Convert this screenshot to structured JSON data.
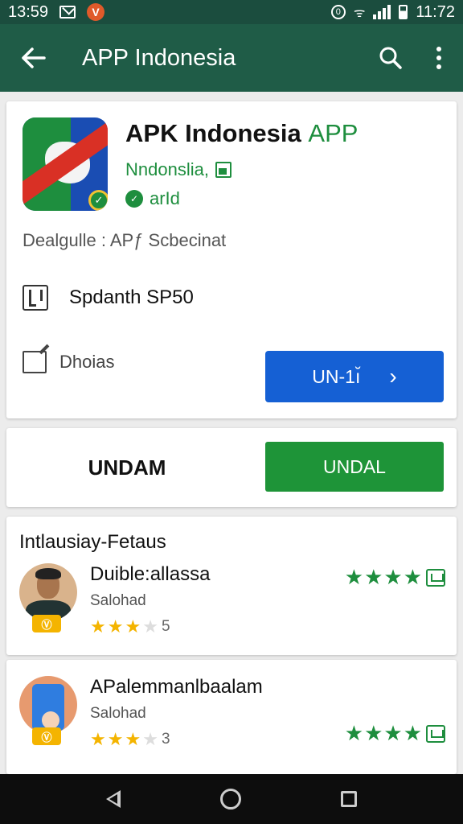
{
  "status_bar": {
    "time": "13:59",
    "notif_badge": "V",
    "right_time": "11:72",
    "circle_icon": "0"
  },
  "appbar": {
    "title": "APP Indonesia"
  },
  "app": {
    "name": "APK Indonesia",
    "name_accent": "APP",
    "developer": "Nndonslia,",
    "rating_text": "arId",
    "description": "Dealgulle : APƒ Scbecinat",
    "size_label": "Spdanth SP50",
    "downloads_label": "Dhoias",
    "install_button": "UN-1ı̆",
    "chevron": "›"
  },
  "action_card": {
    "left_label": "UNDAM",
    "button_label": "UNDAL"
  },
  "reviews_section": {
    "title": "Intlausiay-Fetaus",
    "reviews": [
      {
        "name": "Duible:allassa",
        "subtitle": "Salohad",
        "user_rating": 3,
        "rating_num": "5",
        "app_rating": 4,
        "badge": "Ⓥ"
      },
      {
        "name": "APalemmanlbaalam",
        "subtitle": "Salohad",
        "user_rating": 3,
        "rating_num": "3",
        "app_rating": 4,
        "badge": "Ⓥ"
      }
    ]
  },
  "colors": {
    "status_bar": "#1b4d3e",
    "app_bar": "#1f5c47",
    "accent_green": "#1e8e3e",
    "button_blue": "#1560d4",
    "button_green": "#1e9438",
    "star_yellow": "#f4b400"
  },
  "icons": {
    "back": "arrow-left-icon",
    "search": "search-icon",
    "more": "more-vert-icon"
  }
}
